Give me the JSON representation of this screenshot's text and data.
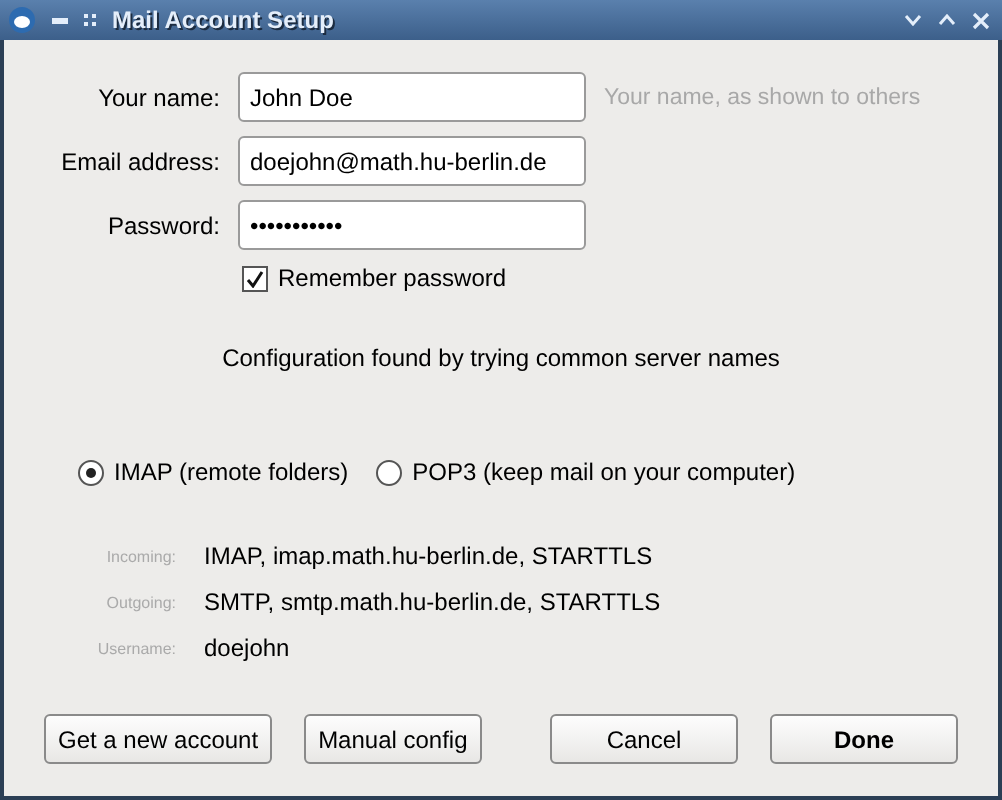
{
  "window": {
    "title": "Mail Account Setup"
  },
  "fields": [
    {
      "label": "Your name:",
      "value": "John Doe",
      "hint": "Your name, as shown to others"
    },
    {
      "label": "Email address:",
      "value": "doejohn@math.hu-berlin.de"
    },
    {
      "label": "Password:",
      "value": "•••••••••••"
    }
  ],
  "remember_password": {
    "label": "Remember password",
    "checked": true
  },
  "status": "Configuration found by trying common server names",
  "protocols": [
    {
      "label": "IMAP (remote folders)",
      "selected": true
    },
    {
      "label": "POP3 (keep mail on your computer)",
      "selected": false
    }
  ],
  "servers": [
    {
      "label": "Incoming:",
      "value": "IMAP, imap.math.hu-berlin.de, STARTTLS"
    },
    {
      "label": "Outgoing:",
      "value": "SMTP, smtp.math.hu-berlin.de, STARTTLS"
    },
    {
      "label": "Username:",
      "value": "doejohn"
    }
  ],
  "buttons_left": [
    "Get a new account",
    "Manual config"
  ],
  "buttons_right": [
    {
      "label": "Cancel",
      "default": false
    },
    {
      "label": "Done",
      "default": true
    }
  ]
}
